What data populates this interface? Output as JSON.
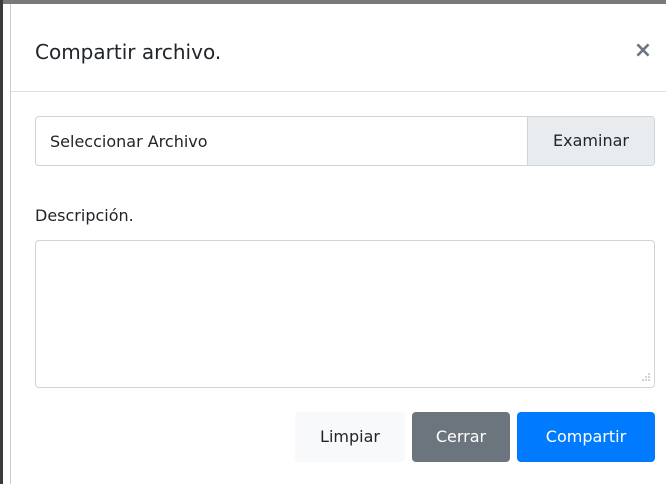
{
  "modal": {
    "title": "Compartir archivo.",
    "close_symbol": "×"
  },
  "file_input": {
    "value": "Seleccionar Archivo",
    "browse_label": "Examinar"
  },
  "description": {
    "label": "Descripción.",
    "value": ""
  },
  "footer": {
    "clear_label": "Limpiar",
    "close_label": "Cerrar",
    "share_label": "Compartir"
  },
  "colors": {
    "primary": "#007bff",
    "secondary": "#6c757d",
    "light": "#f8f9fa"
  },
  "icons": {
    "close": "close-icon",
    "resize": "resize-grip-icon"
  }
}
